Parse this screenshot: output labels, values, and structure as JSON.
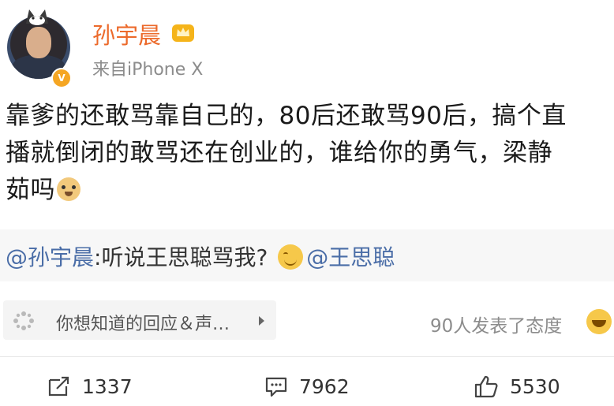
{
  "header": {
    "username": "孙宇晨",
    "source": "来自iPhone X"
  },
  "post": {
    "lines": [
      "靠爹的还敢骂靠自己的，80后还敢骂90后，搞个直",
      "播就倒闭的敢骂还在创业的，谁给你的勇气，梁静",
      "茹吗"
    ]
  },
  "repost": {
    "mention_author": "@孙宇晨",
    "text": ":听说王思聪骂我?",
    "mention_target": "@王思聪"
  },
  "reaction_bar": {
    "label": "你想知道的回应＆声…"
  },
  "attitude": {
    "text": "90人发表了态度"
  },
  "actions": {
    "repost_count": "1337",
    "comment_count": "7962",
    "like_count": "5530"
  },
  "colors": {
    "username": "#ec6a2b",
    "mention": "#4a6da7",
    "verified_badge": "#f5a623"
  },
  "icons": {
    "verified": "verified-v-icon",
    "crown": "crown-icon",
    "doge": "doge-emoji-icon",
    "smile": "smile-emoji-icon",
    "laugh": "laugh-emoji-icon",
    "reaction": "sparkle-icon",
    "repost": "repost-icon",
    "comment": "comment-icon",
    "like": "thumbs-up-icon"
  }
}
